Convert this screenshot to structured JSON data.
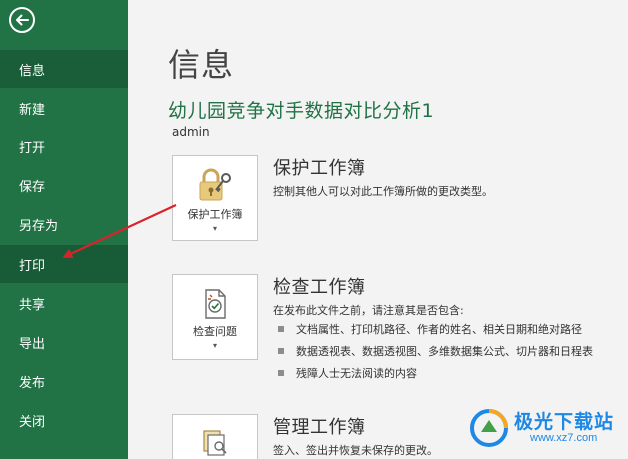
{
  "sidebar": {
    "items": [
      {
        "id": "info",
        "label": "信息",
        "active": false,
        "hover": true
      },
      {
        "id": "new",
        "label": "新建"
      },
      {
        "id": "open",
        "label": "打开"
      },
      {
        "id": "save",
        "label": "保存"
      },
      {
        "id": "saveas",
        "label": "另存为"
      },
      {
        "id": "print",
        "label": "打印",
        "active": true
      },
      {
        "id": "share",
        "label": "共享"
      },
      {
        "id": "export",
        "label": "导出"
      },
      {
        "id": "publish",
        "label": "发布"
      },
      {
        "id": "close",
        "label": "关闭"
      }
    ],
    "back_icon": "back-arrow-icon"
  },
  "main": {
    "title": "信息",
    "doc_title": "幼儿园竞争对手数据对比分析1",
    "doc_path": "admin",
    "sections": [
      {
        "tile_label": "保护工作簿",
        "tile_icon": "lock-key-icon",
        "title": "保护工作簿",
        "desc": "控制其他人可以对此工作簿所做的更改类型。"
      },
      {
        "tile_label": "检查问题",
        "tile_icon": "inspect-document-icon",
        "title": "检查工作簿",
        "desc": "在发布此文件之前，请注意其是否包含:",
        "bullets": [
          "文档属性、打印机路径、作者的姓名、相关日期和绝对路径",
          "数据透视表、数据透视图、多维数据集公式、切片器和日程表",
          "残障人士无法阅读的内容"
        ]
      },
      {
        "tile_label": "",
        "tile_icon": "manage-workbook-icon",
        "title": "管理工作簿",
        "desc": "签入、签出并恢复未保存的更改。"
      }
    ]
  },
  "watermark": {
    "text": "极光下载站",
    "url": "www.xz7.com"
  },
  "colors": {
    "sidebar": "#217346",
    "sidebar_active": "#185c37",
    "accent": "#217346",
    "annotation_arrow": "#d9232a"
  }
}
